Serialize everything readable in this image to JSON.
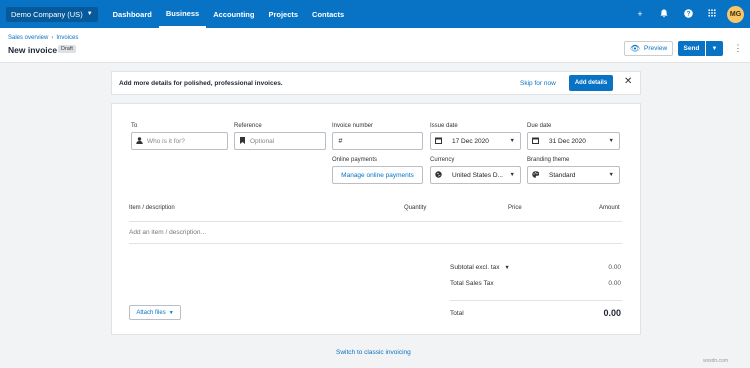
{
  "nav": {
    "org": "Demo Company (US)",
    "items": [
      "Dashboard",
      "Business",
      "Accounting",
      "Projects",
      "Contacts"
    ],
    "active": "Business",
    "icons": [
      "plus-icon",
      "bell-icon",
      "help-icon",
      "grid-icon"
    ],
    "avatar": "MG"
  },
  "header": {
    "breadcrumb": [
      "Sales overview",
      "Invoices"
    ],
    "title": "New invoice",
    "status": "Draft",
    "preview": "Preview",
    "send": "Send"
  },
  "banner": {
    "message": "Add more details for polished, professional invoices.",
    "skip": "Skip for now",
    "add": "Add details"
  },
  "form": {
    "to_label": "To",
    "to_placeholder": "Who is it for?",
    "reference_label": "Reference",
    "reference_placeholder": "Optional",
    "invoice_number_label": "Invoice number",
    "invoice_number_prefix": "#",
    "issue_date_label": "Issue date",
    "issue_date": "17 Dec 2020",
    "due_date_label": "Due date",
    "due_date": "31 Dec 2020",
    "online_payments_label": "Online payments",
    "online_payments_link": "Manage online payments",
    "currency_label": "Currency",
    "currency": "United States D...",
    "branding_label": "Branding theme",
    "branding": "Standard"
  },
  "table": {
    "columns": [
      "Item / description",
      "Quantity",
      "Price",
      "Amount"
    ],
    "add_placeholder": "Add an item / description..."
  },
  "summary": {
    "subtotal_label": "Subtotal excl. tax",
    "subtotal": "0.00",
    "tax_label": "Total Sales Tax",
    "tax": "0.00",
    "total_label": "Total",
    "total": "0.00"
  },
  "attach_label": "Attach files",
  "switch_link": "Switch to classic invoicing",
  "watermark": "wsxdn.com",
  "colors": {
    "brand": "#0873c4",
    "background": "#f2f3f4",
    "avatar": "#f7c66a"
  }
}
